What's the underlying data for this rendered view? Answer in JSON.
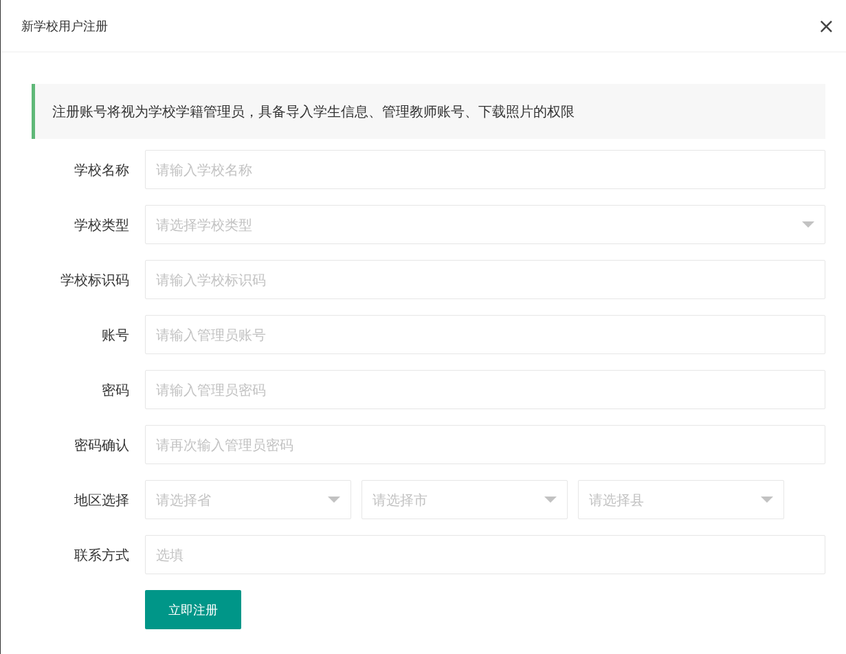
{
  "dialog": {
    "title": "新学校用户注册",
    "close": "×"
  },
  "note": "注册账号将视为学校学籍管理员，具备导入学生信息、管理教师账号、下载照片的权限",
  "form": {
    "rows": [
      {
        "label": "学校名称",
        "fields": [
          {
            "kind": "input",
            "placeholder": "请输入学校名称"
          }
        ]
      },
      {
        "label": "学校类型",
        "fields": [
          {
            "kind": "select",
            "placeholder": "请选择学校类型"
          }
        ]
      },
      {
        "label": "学校标识码",
        "fields": [
          {
            "kind": "input",
            "placeholder": "请输入学校标识码"
          }
        ]
      },
      {
        "label": "账号",
        "fields": [
          {
            "kind": "input",
            "placeholder": "请输入管理员账号"
          }
        ]
      },
      {
        "label": "密码",
        "fields": [
          {
            "kind": "input",
            "placeholder": "请输入管理员密码"
          }
        ]
      },
      {
        "label": "密码确认",
        "fields": [
          {
            "kind": "input",
            "placeholder": "请再次输入管理员密码"
          }
        ]
      },
      {
        "label": "地区选择",
        "fields": [
          {
            "kind": "select",
            "placeholder": "请选择省"
          },
          {
            "kind": "select",
            "placeholder": "请选择市"
          },
          {
            "kind": "select",
            "placeholder": "请选择县"
          }
        ]
      },
      {
        "label": "联系方式",
        "fields": [
          {
            "kind": "input",
            "placeholder": "选填"
          }
        ]
      }
    ],
    "submit": "立即注册"
  }
}
